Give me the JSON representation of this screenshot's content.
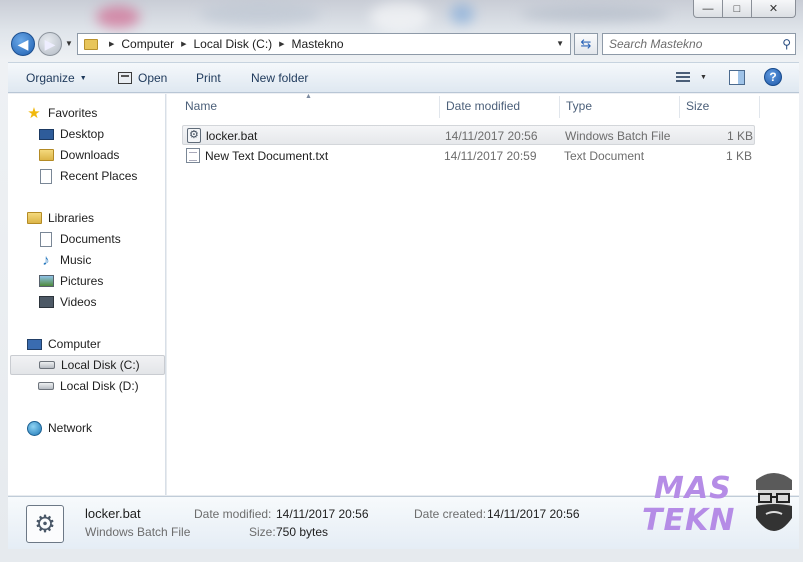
{
  "window": {
    "minimize_glyph": "—",
    "maximize_glyph": "□",
    "close_glyph": "✕"
  },
  "address_bar": {
    "breadcrumbs": [
      "Computer",
      "Local Disk (C:)",
      "Mastekno"
    ]
  },
  "search": {
    "placeholder": "Search Mastekno"
  },
  "toolbar": {
    "organize_label": "Organize",
    "open_label": "Open",
    "print_label": "Print",
    "new_folder_label": "New folder"
  },
  "sidebar": {
    "favorites": {
      "label": "Favorites",
      "items": [
        "Desktop",
        "Downloads",
        "Recent Places"
      ]
    },
    "libraries": {
      "label": "Libraries",
      "items": [
        "Documents",
        "Music",
        "Pictures",
        "Videos"
      ]
    },
    "computer": {
      "label": "Computer",
      "items": [
        "Local Disk (C:)",
        "Local Disk (D:)"
      ],
      "selected": "Local Disk (C:)"
    },
    "network": {
      "label": "Network"
    }
  },
  "file_list": {
    "columns": [
      "Name",
      "Date modified",
      "Type",
      "Size"
    ],
    "rows": [
      {
        "name": "locker.bat",
        "date_modified": "14/11/2017 20:56",
        "type": "Windows Batch File",
        "size": "1 KB",
        "icon": "batch-file-icon",
        "selected": true
      },
      {
        "name": "New Text Document.txt",
        "date_modified": "14/11/2017 20:59",
        "type": "Text Document",
        "size": "1 KB",
        "icon": "text-file-icon",
        "selected": false
      }
    ]
  },
  "details_pane": {
    "name": "locker.bat",
    "type": "Windows Batch File",
    "date_modified_label": "Date modified:",
    "date_modified": "14/11/2017 20:56",
    "size_label": "Size:",
    "size": "750 bytes",
    "date_created_label": "Date created:",
    "date_created": "14/11/2017 20:56"
  },
  "watermark": {
    "line1": "MAS",
    "line2": "TEKN"
  },
  "colors": {
    "accent": "#1e395b",
    "header_text": "#4c607a",
    "secondary_text": "#6d6d6d",
    "watermark": "#b58ce6"
  }
}
